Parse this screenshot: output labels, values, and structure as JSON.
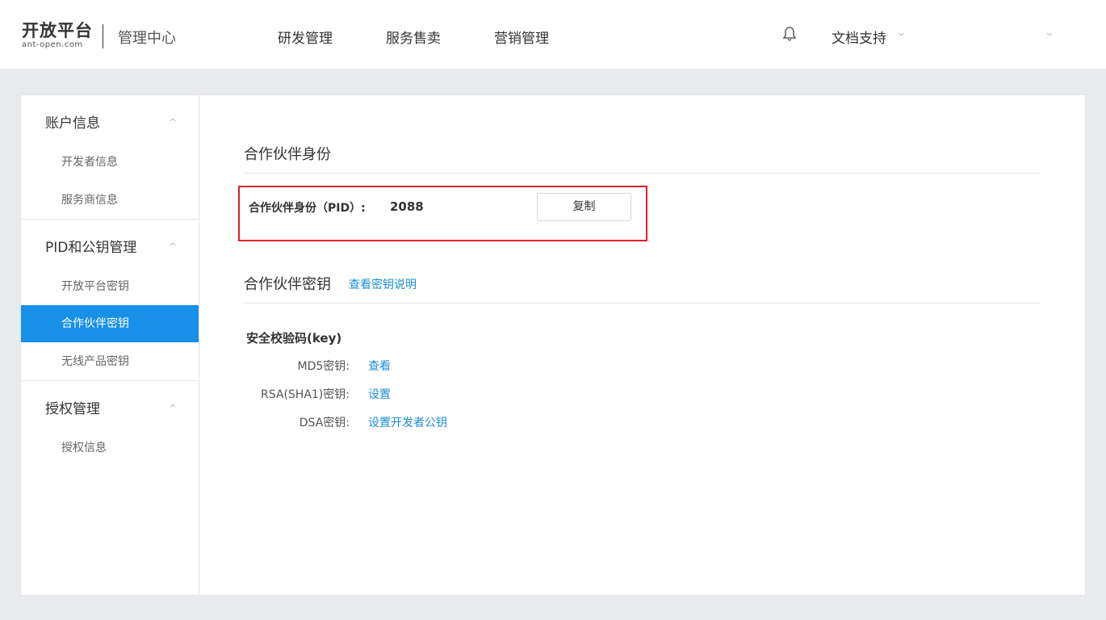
{
  "header": {
    "logo_text": "开放平台",
    "logo_domain": "ant-open.com",
    "app_name": "管理中心",
    "nav": [
      "研发管理",
      "服务售卖",
      "营销管理"
    ],
    "docs_label": "文档支持"
  },
  "sidebar": {
    "groups": [
      {
        "title": "账户信息",
        "items": [
          "开发者信息",
          "服务商信息"
        ]
      },
      {
        "title": "PID和公钥管理",
        "items": [
          "开放平台密钥",
          "合作伙伴密钥",
          "无线产品密钥"
        ]
      },
      {
        "title": "授权管理",
        "items": [
          "授权信息"
        ]
      }
    ],
    "active_item": "合作伙伴密钥"
  },
  "main": {
    "partner_identity_title": "合作伙伴身份",
    "pid_label": "合作伙伴身份（PID）:",
    "pid_value": "2088",
    "copy_button": "复制",
    "partner_key_title": "合作伙伴密钥",
    "key_explain_link": "查看密钥说明",
    "security_key_heading": "安全校验码(key)",
    "keys": [
      {
        "label": "MD5密钥:",
        "action": "查看"
      },
      {
        "label": "RSA(SHA1)密钥:",
        "action": "设置"
      },
      {
        "label": "DSA密钥:",
        "action": "设置开发者公钥"
      }
    ]
  },
  "colors": {
    "accent": "#1890e8",
    "link": "#1a8fd6",
    "highlight_border": "#e0202a",
    "page_background": "#e9eaee"
  }
}
